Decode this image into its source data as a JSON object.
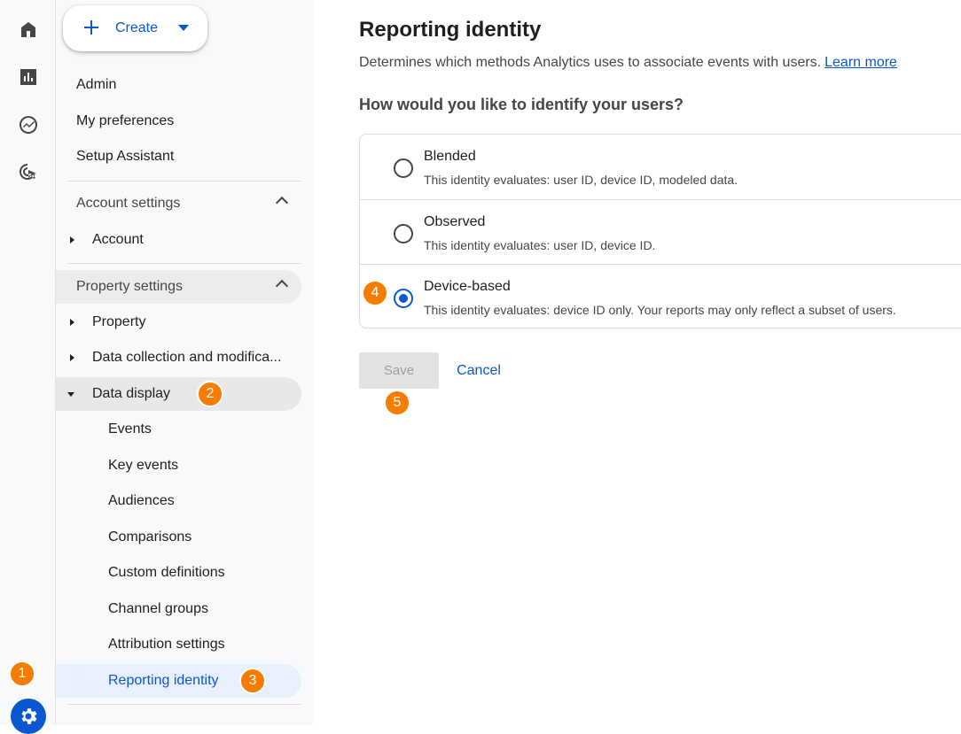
{
  "create_button": {
    "label": "Create"
  },
  "nav": {
    "top_items": [
      {
        "label": "Admin"
      },
      {
        "label": "My preferences"
      },
      {
        "label": "Setup Assistant"
      }
    ],
    "account_settings": {
      "label": "Account settings",
      "items": [
        {
          "label": "Account"
        }
      ]
    },
    "property_settings": {
      "label": "Property settings",
      "items": [
        {
          "label": "Property"
        },
        {
          "label": "Data collection and modifica..."
        },
        {
          "label": "Data display"
        }
      ]
    },
    "data_display_items": [
      {
        "label": "Events"
      },
      {
        "label": "Key events"
      },
      {
        "label": "Audiences"
      },
      {
        "label": "Comparisons"
      },
      {
        "label": "Custom definitions"
      },
      {
        "label": "Channel groups"
      },
      {
        "label": "Attribution settings"
      },
      {
        "label": "Reporting identity"
      }
    ]
  },
  "badges": [
    "1",
    "2",
    "3",
    "4",
    "5"
  ],
  "main": {
    "title": "Reporting identity",
    "description": "Determines which methods Analytics uses to associate events with users.",
    "learn_more": "Learn more",
    "question": "How would you like to identify your users?",
    "options": [
      {
        "title": "Blended",
        "subtitle": "This identity evaluates: user ID, device ID, modeled data.",
        "selected": false
      },
      {
        "title": "Observed",
        "subtitle": "This identity evaluates: user ID, device ID.",
        "selected": false
      },
      {
        "title": "Device-based",
        "subtitle": "This identity evaluates: device ID only. Your reports may only reflect a subset of users.",
        "selected": true
      }
    ],
    "save_label": "Save",
    "cancel_label": "Cancel"
  },
  "colors": {
    "accent": "#0b57d0",
    "badge": "#f57c00",
    "selected_nav_bg": "#e8f0fe",
    "hover_nav_bg": "#e8e8e8"
  },
  "icons": [
    "home-icon",
    "reports-icon",
    "explore-icon",
    "advertising-icon",
    "admin-gear-icon",
    "plus-icon",
    "caret-down-icon"
  ]
}
